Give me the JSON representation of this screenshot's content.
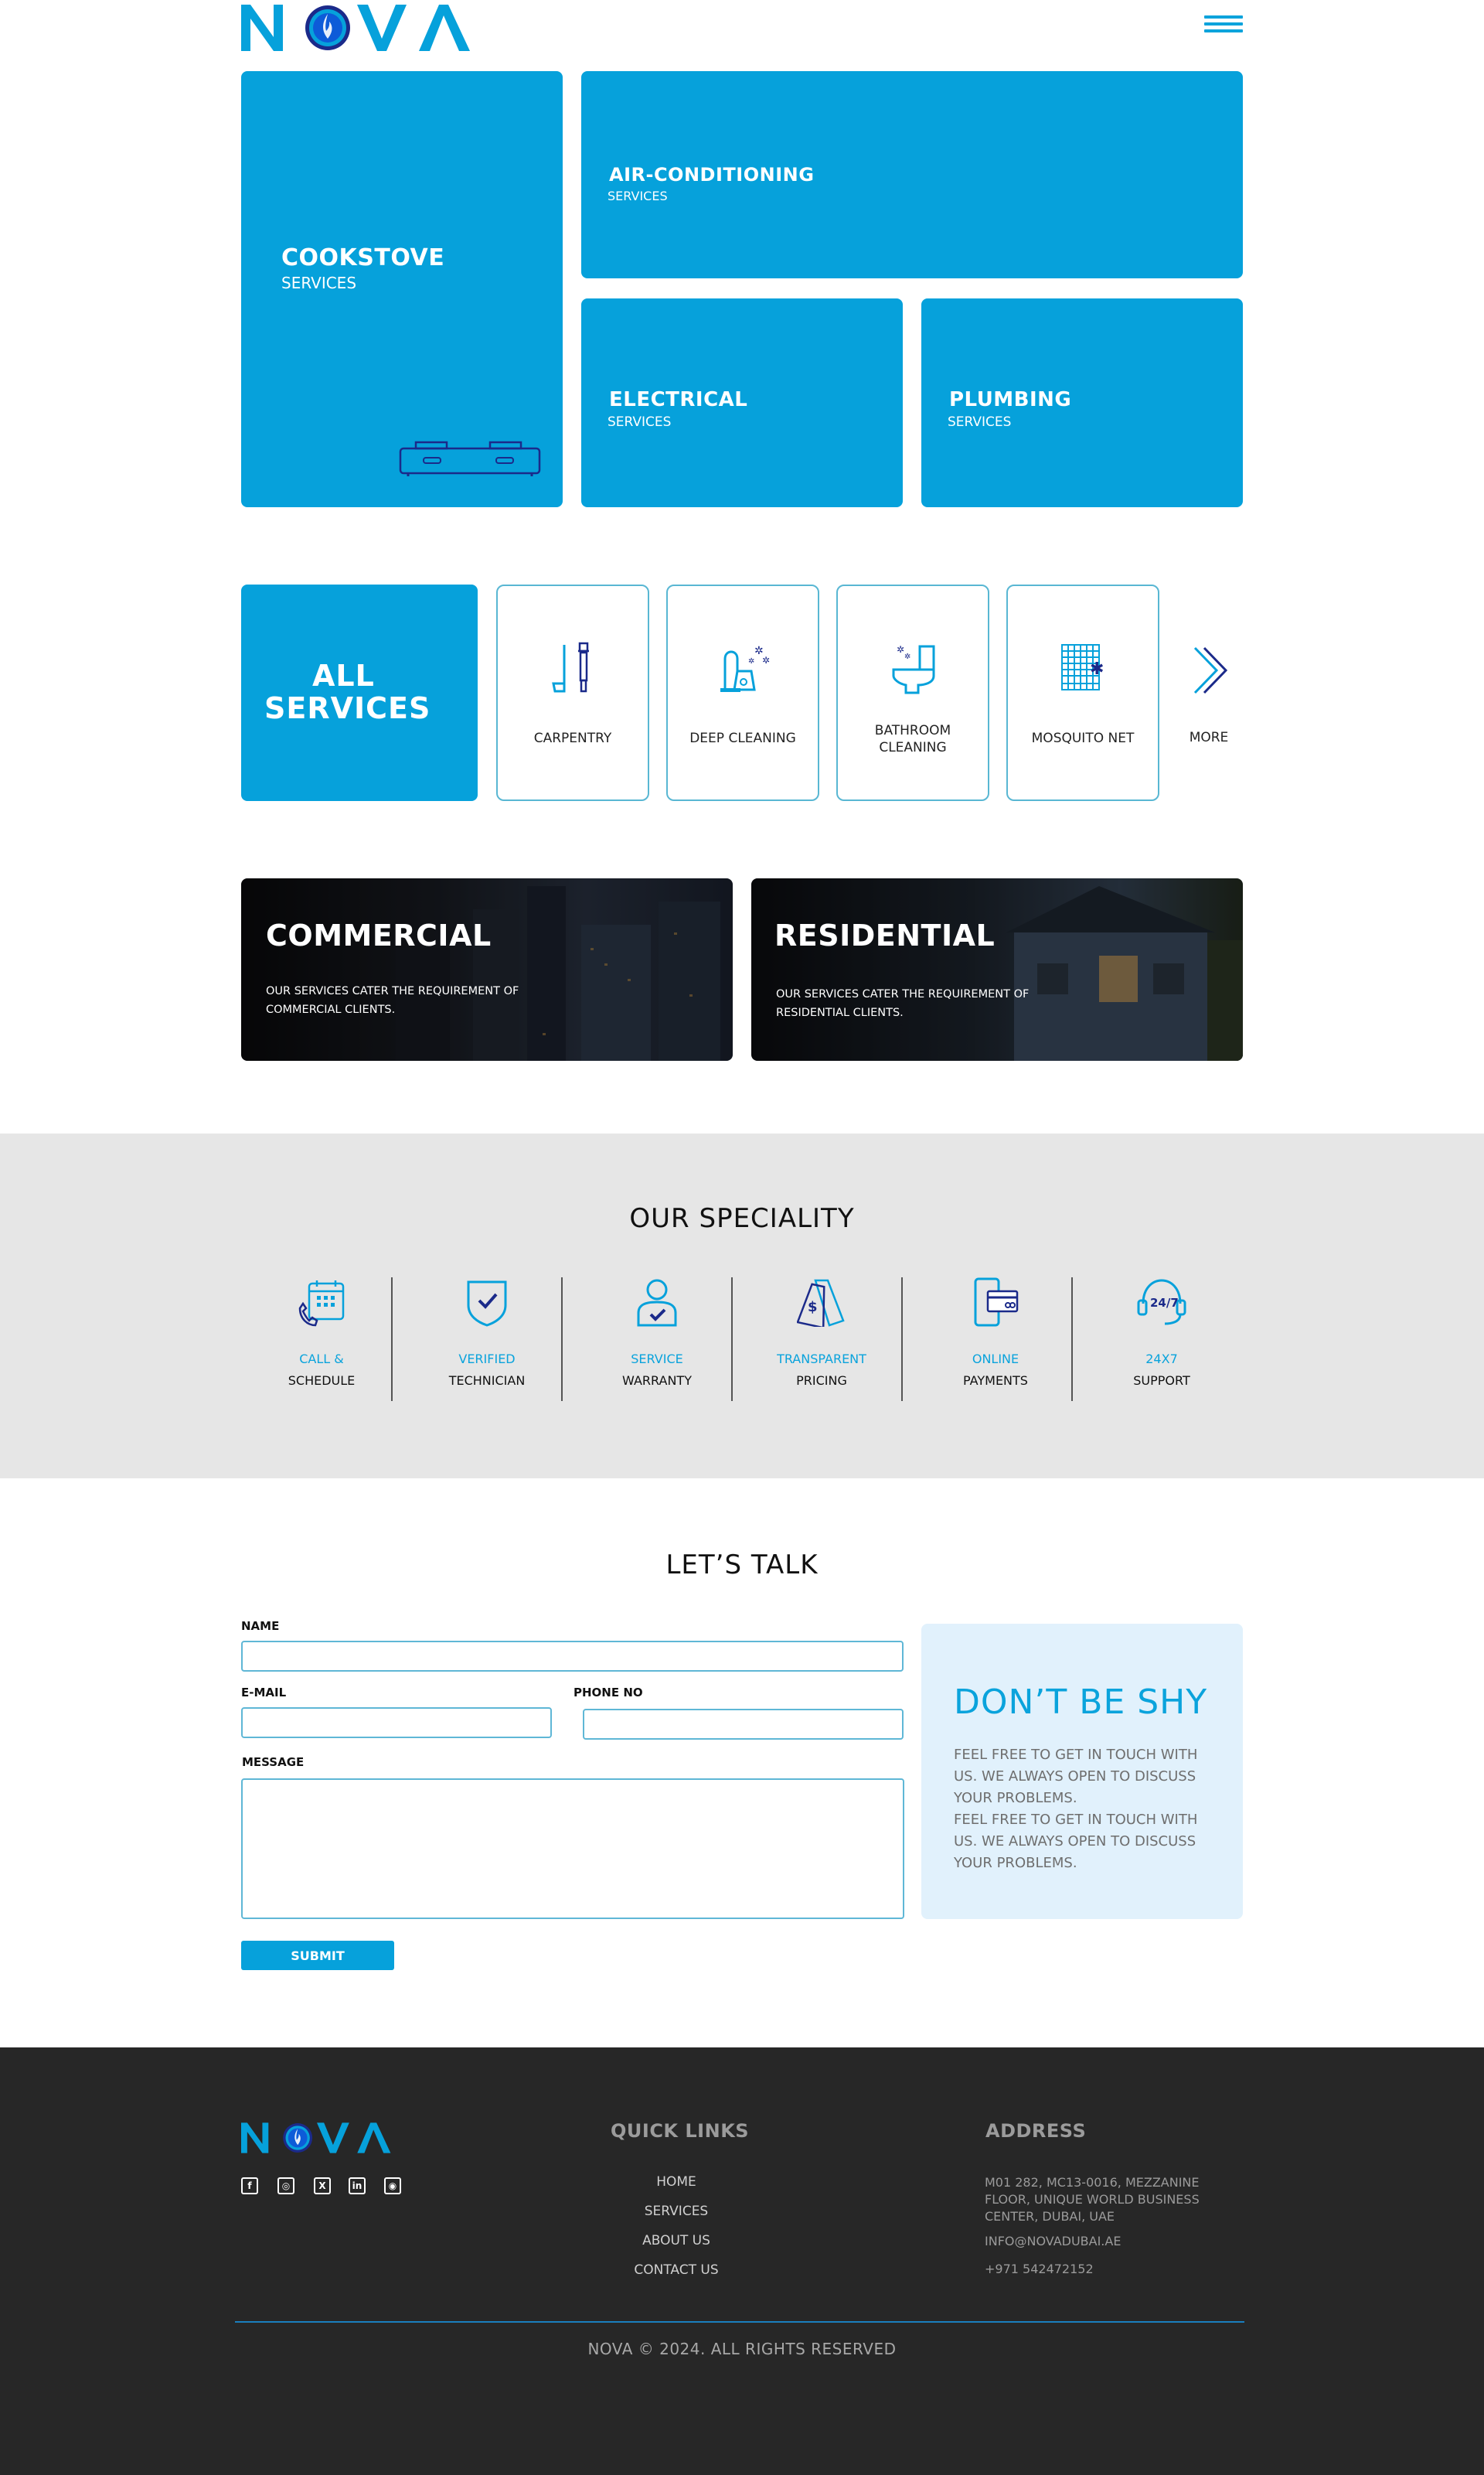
{
  "brand": {
    "name": "NOVA",
    "primary_color": "#06a1db",
    "dark_blue": "#1b2a8a"
  },
  "header": {
    "menu_icon": "hamburger-icon"
  },
  "tiles": {
    "cookstove": {
      "title": "COOKSTOVE",
      "sub": "SERVICES",
      "icon": "cookstove-icon"
    },
    "ac": {
      "title": "AIR-CONDITIONING",
      "sub": "SERVICES"
    },
    "electrical": {
      "title": "ELECTRICAL",
      "sub": "SERVICES"
    },
    "plumbing": {
      "title": "PLUMBING",
      "sub": "SERVICES"
    }
  },
  "all_services": {
    "line1": "ALL",
    "line2": "SERVICES",
    "items": [
      {
        "label": "CARPENTRY",
        "icon": "carpentry-tools-icon"
      },
      {
        "label": "DEEP CLEANING",
        "icon": "vacuum-cleaner-icon"
      },
      {
        "label1": "BATHROOM",
        "label2": "CLEANING",
        "icon": "toilet-icon"
      },
      {
        "label": "MOSQUITO NET",
        "icon": "mosquito-net-icon"
      }
    ],
    "more": {
      "label": "MORE",
      "icon": "double-chevron-right-icon"
    }
  },
  "banners": {
    "commercial": {
      "title": "COMMERCIAL",
      "desc1": "OUR SERVICES CATER THE REQUIREMENT OF",
      "desc2": "COMMERCIAL CLIENTS."
    },
    "residential": {
      "title": "RESIDENTIAL",
      "desc1": "OUR SERVICES CATER THE REQUIREMENT OF",
      "desc2": "RESIDENTIAL CLIENTS."
    }
  },
  "speciality": {
    "title": "OUR SPECIALITY",
    "items": [
      {
        "line1": "CALL &",
        "line2": "SCHEDULE",
        "icon": "phone-calendar-icon"
      },
      {
        "line1": "VERIFIED",
        "line2": "TECHNICIAN",
        "icon": "shield-check-icon"
      },
      {
        "line1": "SERVICE",
        "line2": "WARRANTY",
        "icon": "user-check-icon"
      },
      {
        "line1": "TRANSPARENT",
        "line2": "PRICING",
        "icon": "price-tag-icon"
      },
      {
        "line1": "ONLINE",
        "line2": "PAYMENTS",
        "icon": "mobile-payment-icon"
      },
      {
        "line1": "24X7",
        "line2": "SUPPORT",
        "icon": "headset-24-7-icon"
      }
    ],
    "support_badge": "24/7"
  },
  "contact": {
    "title": "LET’S TALK",
    "name_label": "NAME",
    "email_label": "E-MAIL",
    "phone_label": "PHONE NO",
    "message_label": "MESSAGE",
    "name_value": "",
    "email_value": "",
    "phone_value": "",
    "message_value": "",
    "submit_label": "SUBMIT",
    "shy_title": "DON’T BE SHY",
    "shy_text1": "FEEL FREE TO GET IN TOUCH WITH US. WE ALWAYS OPEN TO DISCUSS YOUR PROBLEMS.",
    "shy_text2": "FEEL FREE TO GET IN TOUCH WITH US. WE ALWAYS OPEN TO DISCUSS YOUR PROBLEMS."
  },
  "footer": {
    "social": [
      {
        "icon": "facebook-icon",
        "glyph": "f"
      },
      {
        "icon": "whatsapp-icon",
        "glyph": "◎"
      },
      {
        "icon": "x-twitter-icon",
        "glyph": "X"
      },
      {
        "icon": "linkedin-icon",
        "glyph": "in"
      },
      {
        "icon": "instagram-icon",
        "glyph": "◉"
      }
    ],
    "quick_links_title": "QUICK LINKS",
    "links": [
      "HOME",
      "SERVICES",
      "ABOUT US",
      "CONTACT US"
    ],
    "address_title": "ADDRESS",
    "address": "M01 282, MC13-0016, MEZZANINE FLOOR, UNIQUE WORLD BUSINESS CENTER, DUBAI, UAE",
    "email": "INFO@NOVADUBAI.AE",
    "phone": "+971 542472152",
    "copyright": "NOVA © 2024. ALL RIGHTS RESERVED"
  }
}
